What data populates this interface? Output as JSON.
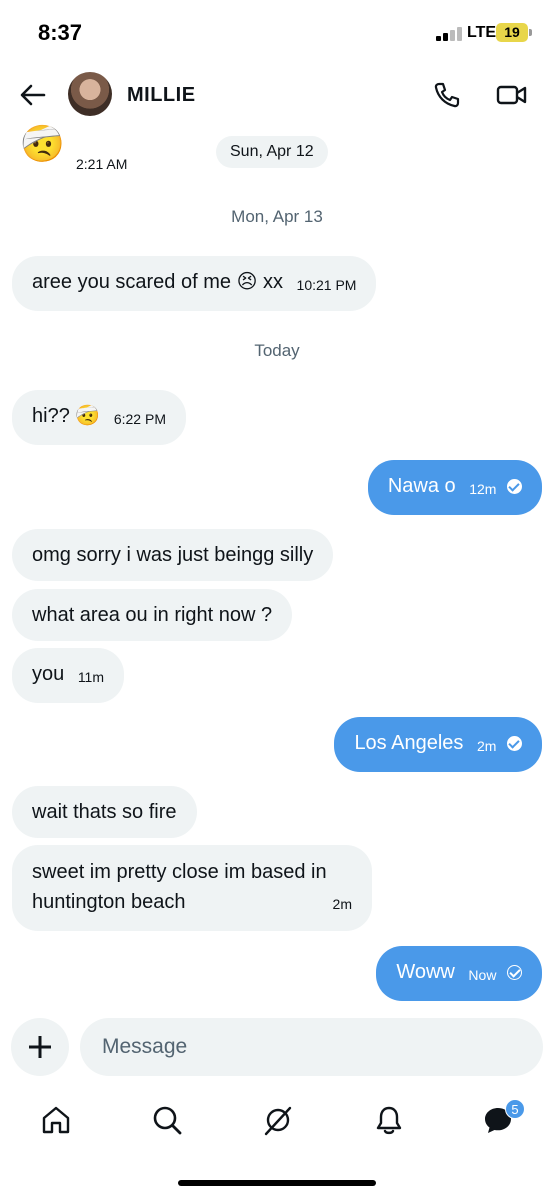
{
  "status_bar": {
    "time": "8:37",
    "network": "LTE",
    "battery": "19"
  },
  "header": {
    "contact_name": "MILLIE",
    "back_icon": "arrow-left-icon",
    "call_icon": "phone-icon",
    "video_icon": "video-camera-icon"
  },
  "messages": {
    "sticker": {
      "emoji": "🤕",
      "time": "2:21 AM"
    },
    "date_pill": "Sun, Apr 12",
    "day_2": "Mon, Apr 13",
    "m1": {
      "text": "aree you scared of me",
      "emoji": "😣",
      "suffix": "xx",
      "time": "10:21 PM"
    },
    "day_3": "Today",
    "m2": {
      "text": "hi??",
      "emoji": "🤕",
      "time": "6:22 PM"
    },
    "m3": {
      "text": "Nawa o",
      "time": "12m"
    },
    "m4": {
      "text": "omg sorry i was just beingg silly"
    },
    "m5": {
      "text": "what area ou in right now ?"
    },
    "m6": {
      "text": "you",
      "time": "11m"
    },
    "m7": {
      "text": "Los Angeles",
      "time": "2m"
    },
    "m8": {
      "text": "wait thats so fire"
    },
    "m9": {
      "text": "sweet im pretty close im based in huntington beach",
      "time": "2m"
    },
    "m10": {
      "text": "Woww",
      "time": "Now"
    }
  },
  "composer": {
    "placeholder": "Message"
  },
  "tabbar": {
    "items": [
      "home-icon",
      "search-icon",
      "grok-icon",
      "notifications-bell-icon",
      "messages-icon"
    ],
    "messages_badge": "5"
  },
  "colors": {
    "accent": "#4a99e9",
    "incoming_bg": "#eff3f4",
    "muted_text": "#536471"
  }
}
